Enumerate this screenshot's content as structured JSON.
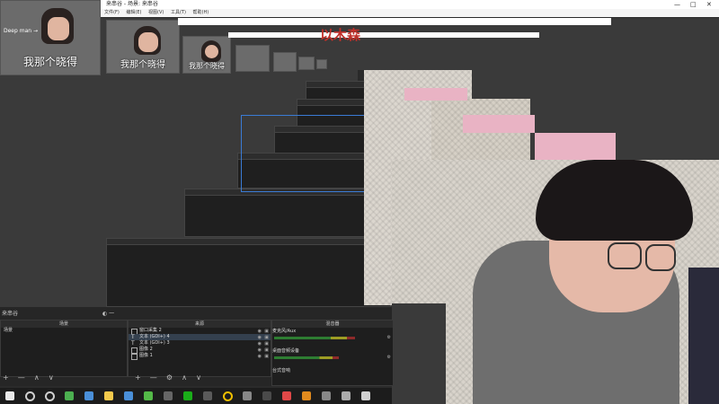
{
  "titlebar": {
    "title": "来串谷 - 场景: 来串谷",
    "min": "—",
    "max": "□",
    "close": "✕"
  },
  "menubar": {
    "items": [
      "文件(F)",
      "编辑(E)",
      "视图(V)",
      "工具(T)",
      "帮助(H)"
    ]
  },
  "preview": {
    "thumb_caption": "我那个晓得",
    "thumb_tag": "Deep man →",
    "overlay_text": "以木森"
  },
  "scenes_panel": {
    "tab_label": "来串谷",
    "tab_extra": "◐ 一",
    "header": "场景",
    "items": [
      "场景"
    ]
  },
  "sources_panel": {
    "header": "来源",
    "items": [
      {
        "name": "窗口采集 2"
      },
      {
        "name": "文本 (GDI+) 4"
      },
      {
        "name": "文本 (GDI+) 3"
      },
      {
        "name": "图像 2"
      },
      {
        "name": "图像 1"
      }
    ]
  },
  "mixer_panel": {
    "header": "混音器",
    "channels": [
      {
        "name": "麦克风/Aux",
        "level": 0.75
      },
      {
        "name": "桌面音频设备",
        "level": 0.6
      },
      {
        "name": "台式音响",
        "level": 0.4
      }
    ]
  },
  "controls": {
    "add": "+",
    "remove": "—",
    "up": "∧",
    "down": "∨",
    "gear": "⚙"
  },
  "taskbar": {
    "icons": [
      "windows-icon",
      "search-icon",
      "cortana-icon",
      "chat-icon",
      "mail-icon",
      "folder-icon",
      "store-icon",
      "green-circle-icon",
      "camera-icon",
      "wechat-icon",
      "monitor-icon",
      "yellow-ring-icon",
      "gallery-icon",
      "media-icon",
      "red-app-icon",
      "obs-highlight-icon",
      "phone-icon",
      "tool-icon",
      "obs-icon"
    ],
    "colors": [
      "#e8e8e8",
      "#cfcfcf",
      "#cfcfcf",
      "#4caf50",
      "#4a8fd8",
      "#f2c94c",
      "#4a8fd8",
      "#54b948",
      "#666666",
      "#1aad19",
      "#5a5a5a",
      "#f0c000",
      "#888888",
      "#4a4a4a",
      "#e04848",
      "#e08a1e",
      "#888888",
      "#aaaaaa",
      "#d0d0d0"
    ]
  }
}
